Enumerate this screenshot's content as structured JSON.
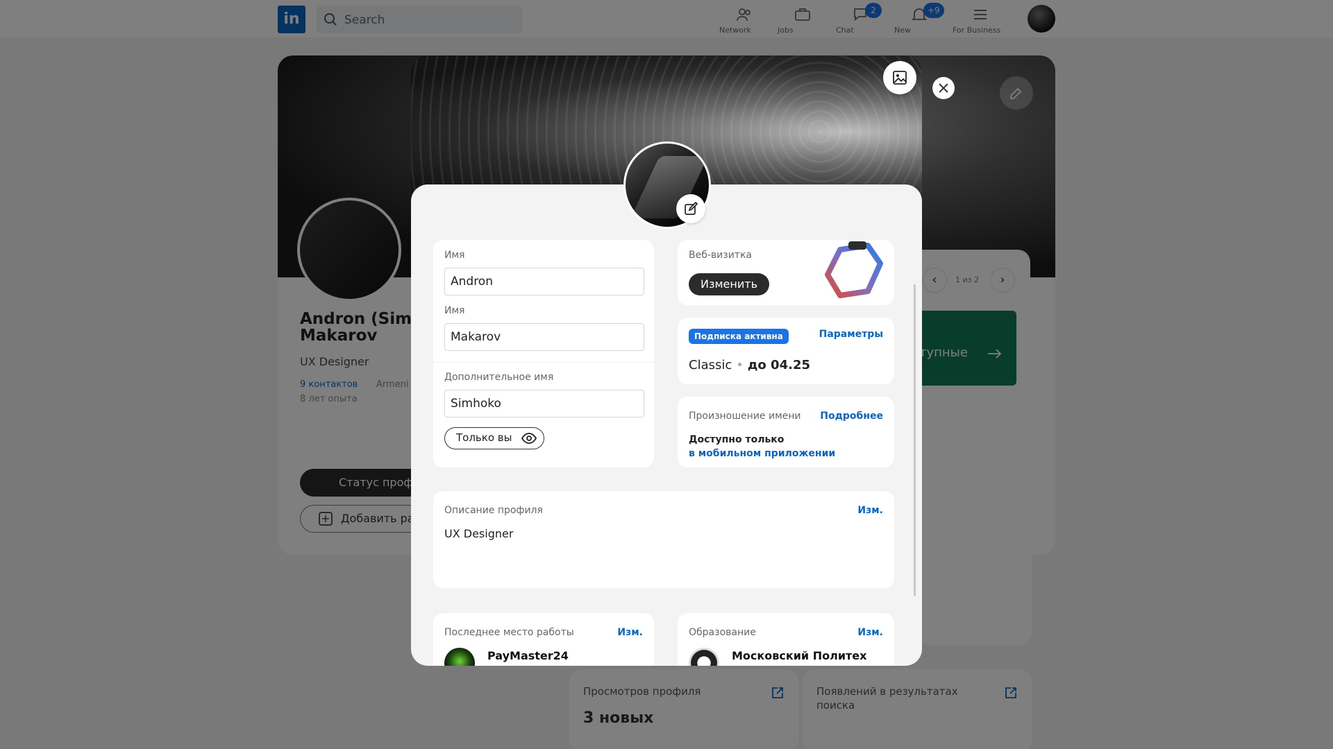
{
  "topbar": {
    "logo_text": "in",
    "search_placeholder": "Search",
    "nav": [
      {
        "label": "Network",
        "icon": "network-icon",
        "badge": ""
      },
      {
        "label": "Jobs",
        "icon": "briefcase-icon",
        "badge": ""
      },
      {
        "label": "Chat",
        "icon": "chat-icon",
        "badge": "2"
      },
      {
        "label": "New",
        "icon": "bell-icon",
        "badge": "+9"
      },
      {
        "label": "For Business",
        "icon": "menu-icon",
        "badge": ""
      }
    ]
  },
  "profile": {
    "name": "Andron (Simhoko) Makarov",
    "name_line1": "Andron (Simh",
    "name_line2": "Makarov",
    "role": "UX Designer",
    "contacts": "9 контактов",
    "location": "Armeni",
    "experience": "8 лет опыта",
    "status_btn": "Статус проф",
    "add_btn": "Добавить ра"
  },
  "side": {
    "pager": "1 из 2",
    "green_text": "тупные"
  },
  "stats": {
    "views_title": "Просмотров профиля",
    "views_value": "3 новых",
    "search_title": "Появлений в результатах поиска"
  },
  "modal": {
    "first_name_label": "Имя",
    "first_name_value": "Andron",
    "last_name_label": "Имя",
    "last_name_value": "Makarov",
    "extra_name_label": "Дополнительное имя",
    "extra_name_value": "Simhoko",
    "visibility_label": "Только вы",
    "webcard_label": "Веб-визитка",
    "webcard_button": "Изменить",
    "subscription_badge": "Подписка активна",
    "subscription_params": "Параметры",
    "plan_name": "Classic",
    "plan_until": "до 04.25",
    "pronunciation_label": "Произношение имени",
    "pronunciation_more": "Подробнее",
    "pronunciation_line1": "Доступно только",
    "pronunciation_line2": "в мобильном приложении",
    "description_label": "Описание профиля",
    "description_edit": "Изм.",
    "description_value": "UX Designer",
    "work_label": "Последнее место работы",
    "work_edit": "Изм.",
    "work_value": "PayMaster24",
    "education_label": "Образование",
    "education_edit": "Изм.",
    "education_value": "Московский Политех"
  },
  "colors": {
    "brand": "#0a66c2",
    "badge": "#1a73e8",
    "green": "#0f7a55"
  }
}
